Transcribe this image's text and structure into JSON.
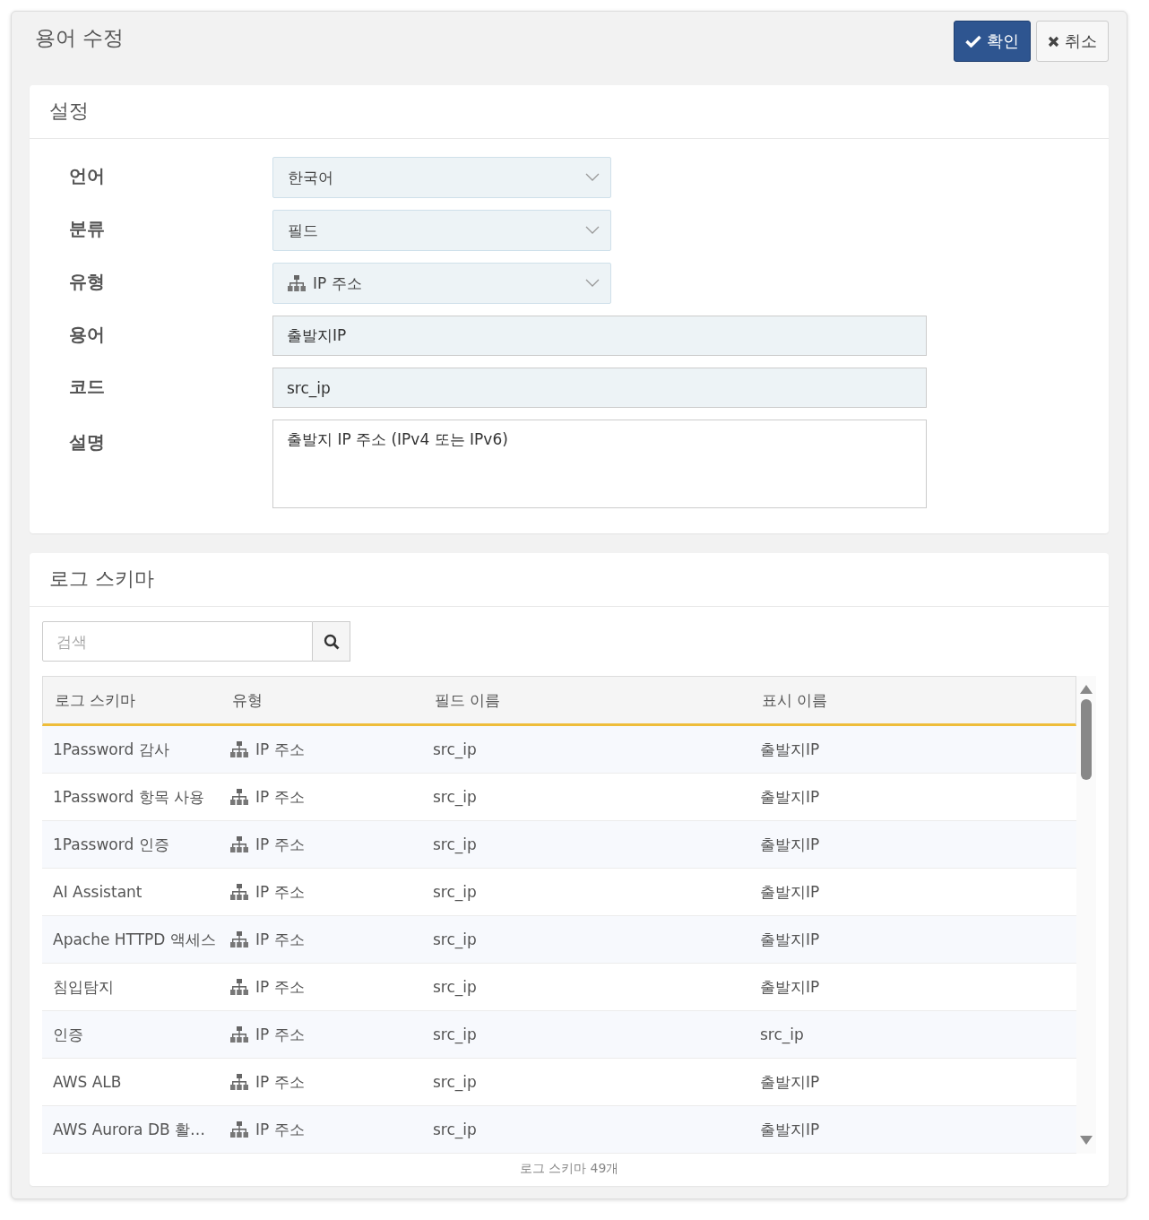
{
  "dialog": {
    "title": "용어 수정",
    "buttons": [
      {
        "kind": "primary",
        "label": "확인"
      },
      {
        "kind": "default",
        "label": "취소"
      }
    ]
  },
  "settings": {
    "title": "설정",
    "fields": [
      {
        "label": "언어",
        "kind": "select",
        "value": "한국어"
      },
      {
        "label": "분류",
        "kind": "select",
        "value": "필드"
      },
      {
        "label": "유형",
        "kind": "icon-select",
        "value": "IP 주소"
      },
      {
        "label": "용어",
        "kind": "input",
        "value": "출발지IP"
      },
      {
        "label": "코드",
        "kind": "input",
        "value": "src_ip"
      },
      {
        "label": "설명",
        "kind": "textarea",
        "value": "출발지 IP 주소 (IPv4 또는 IPv6)"
      }
    ]
  },
  "schema": {
    "title": "로그 스키마",
    "search": {
      "placeholder": "검색"
    },
    "table": {
      "columns": [
        "로그 스키마",
        "유형",
        "필드 이름",
        "표시 이름"
      ],
      "rows": [
        {
          "schema": "1Password 감사",
          "type": "IP 주소",
          "field": "src_ip",
          "display": "출발지IP"
        },
        {
          "schema": "1Password 항목 사용",
          "type": "IP 주소",
          "field": "src_ip",
          "display": "출발지IP"
        },
        {
          "schema": "1Password 인증",
          "type": "IP 주소",
          "field": "src_ip",
          "display": "출발지IP"
        },
        {
          "schema": "AI Assistant",
          "type": "IP 주소",
          "field": "src_ip",
          "display": "출발지IP"
        },
        {
          "schema": "Apache HTTPD 액세스",
          "type": "IP 주소",
          "field": "src_ip",
          "display": "출발지IP"
        },
        {
          "schema": "침입탐지",
          "type": "IP 주소",
          "field": "src_ip",
          "display": "출발지IP"
        },
        {
          "schema": "인증",
          "type": "IP 주소",
          "field": "src_ip",
          "display": "src_ip"
        },
        {
          "schema": "AWS ALB",
          "type": "IP 주소",
          "field": "src_ip",
          "display": "출발지IP"
        },
        {
          "schema": "AWS Aurora DB 활…",
          "type": "IP 주소",
          "field": "src_ip",
          "display": "출발지IP"
        }
      ]
    },
    "footer": "로그 스키마 49개"
  }
}
